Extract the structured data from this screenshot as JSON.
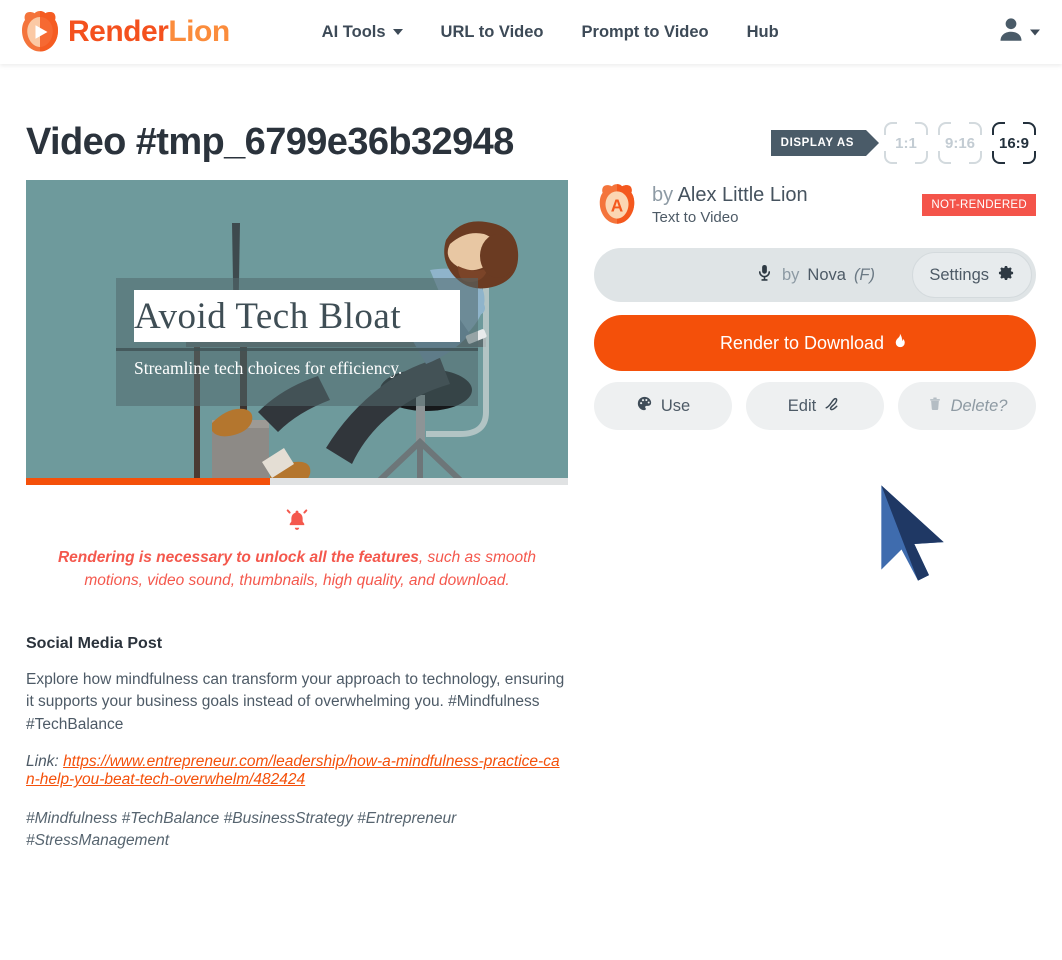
{
  "header": {
    "brand": {
      "part1": "Render",
      "part2": "Lion",
      "logo_icon": "lion-play-logo"
    },
    "nav": [
      {
        "label": "AI Tools",
        "has_caret": true
      },
      {
        "label": "URL to Video",
        "has_caret": false
      },
      {
        "label": "Prompt to Video",
        "has_caret": false
      },
      {
        "label": "Hub",
        "has_caret": false
      }
    ],
    "user_menu": {
      "icon": "user-avatar-icon",
      "caret_icon": "chevron-down-icon"
    }
  },
  "page": {
    "title": "Video #tmp_6799e36b32948"
  },
  "display_as": {
    "label": "DISPLAY AS",
    "options": [
      {
        "label": "1:1",
        "active": false
      },
      {
        "label": "9:16",
        "active": false
      },
      {
        "label": "16:9",
        "active": true
      }
    ]
  },
  "video": {
    "title": "Avoid Tech Bloat",
    "subtitle": "Streamline tech choices for efficiency.",
    "progress_percent": 45,
    "progress_color": "#f4500a",
    "background_color": "#6e9a9c"
  },
  "notice": {
    "icon": "bell-ringing-icon",
    "bold_text": "Rendering is necessary to unlock all the features",
    "rest_text": ", such as smooth motions, video sound, thumbnails, high quality, and download.",
    "color": "#f4584d"
  },
  "post": {
    "heading": "Social Media Post",
    "body": "Explore how mindfulness can transform your approach to technology, ensuring it supports your business goals instead of overwhelming you. #Mindfulness #TechBalance",
    "link_label": "Link:",
    "link_url": "https://www.entrepreneur.com/leadership/how-a-mindfulness-practice-can-help-you-beat-tech-overwhelm/482424",
    "tags": "#Mindfulness #TechBalance #BusinessStrategy #Entrepreneur #StressManagement"
  },
  "author": {
    "avatar_icon": "lion-avatar-icon",
    "avatar_letter": "A",
    "by_label": "by",
    "name": "Alex Little Lion",
    "type": "Text to Video",
    "status_badge": "NOT-RENDERED",
    "status_color": "#f4544a"
  },
  "voice": {
    "mic_icon": "microphone-icon",
    "by_label": "by",
    "name": "Nova",
    "gender": "(F)",
    "settings_label": "Settings",
    "settings_icon": "gear-icon"
  },
  "actions": {
    "render_label": "Render to Download",
    "render_icon": "flame-icon",
    "render_color": "#f4500a",
    "use_label": "Use",
    "use_icon": "palette-icon",
    "edit_label": "Edit",
    "edit_icon": "pen-icon",
    "delete_label": "Delete?",
    "delete_icon": "trash-icon"
  },
  "cursor": {
    "icon": "mouse-pointer-cursor"
  }
}
